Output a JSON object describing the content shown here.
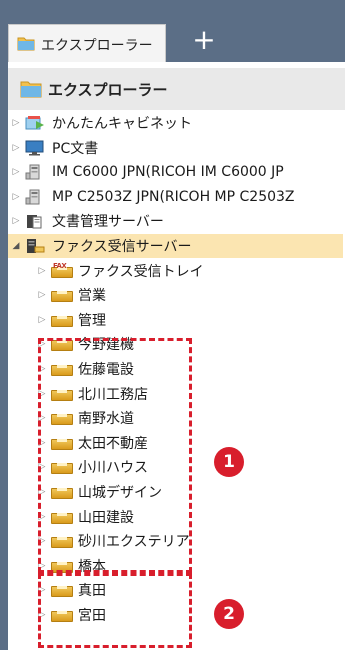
{
  "tabbar": {
    "tab_label": "エクスプローラー",
    "new_tab_symbol": "+"
  },
  "panel": {
    "header_title": "エクスプローラー"
  },
  "tree": {
    "items": [
      {
        "label": "かんたんキャビネット",
        "icon": "cabinet-icon"
      },
      {
        "label": "PC文書",
        "icon": "pc-monitor-icon"
      },
      {
        "label": "IM C6000 JPN(RICOH IM C6000 JP",
        "icon": "printer-icon"
      },
      {
        "label": "MP C2503Z JPN(RICOH MP C2503Z",
        "icon": "printer-icon"
      },
      {
        "label": "文書管理サーバー",
        "icon": "document-server-icon"
      },
      {
        "label": "ファクス受信サーバー",
        "icon": "fax-server-icon",
        "expanded": true,
        "selected": true
      },
      {
        "label": "ファクス受信トレイ",
        "icon": "fax-inbox-icon"
      },
      {
        "label": "営業",
        "icon": "tray-icon"
      },
      {
        "label": "管理",
        "icon": "tray-icon"
      },
      {
        "label": "今野建機",
        "icon": "tray-icon"
      },
      {
        "label": "佐藤電設",
        "icon": "tray-icon"
      },
      {
        "label": "北川工務店",
        "icon": "tray-icon"
      },
      {
        "label": "南野水道",
        "icon": "tray-icon"
      },
      {
        "label": "太田不動産",
        "icon": "tray-icon"
      },
      {
        "label": "小川ハウス",
        "icon": "tray-icon"
      },
      {
        "label": "山城デザイン",
        "icon": "tray-icon"
      },
      {
        "label": "山田建設",
        "icon": "tray-icon"
      },
      {
        "label": "砂川エクステリア",
        "icon": "tray-icon"
      },
      {
        "label": "橋本",
        "icon": "tray-icon"
      },
      {
        "label": "真田",
        "icon": "tray-icon"
      },
      {
        "label": "宮田",
        "icon": "tray-icon"
      }
    ],
    "fax_icon_text": "FAX"
  },
  "annotations": {
    "badge_1": "1",
    "badge_2": "2"
  },
  "colors": {
    "tabbar_bg": "#5b6e86",
    "selected_row_bg": "#fbe5b1",
    "annotation_red": "#d81e2c",
    "header_bg": "#e9e9e9"
  }
}
